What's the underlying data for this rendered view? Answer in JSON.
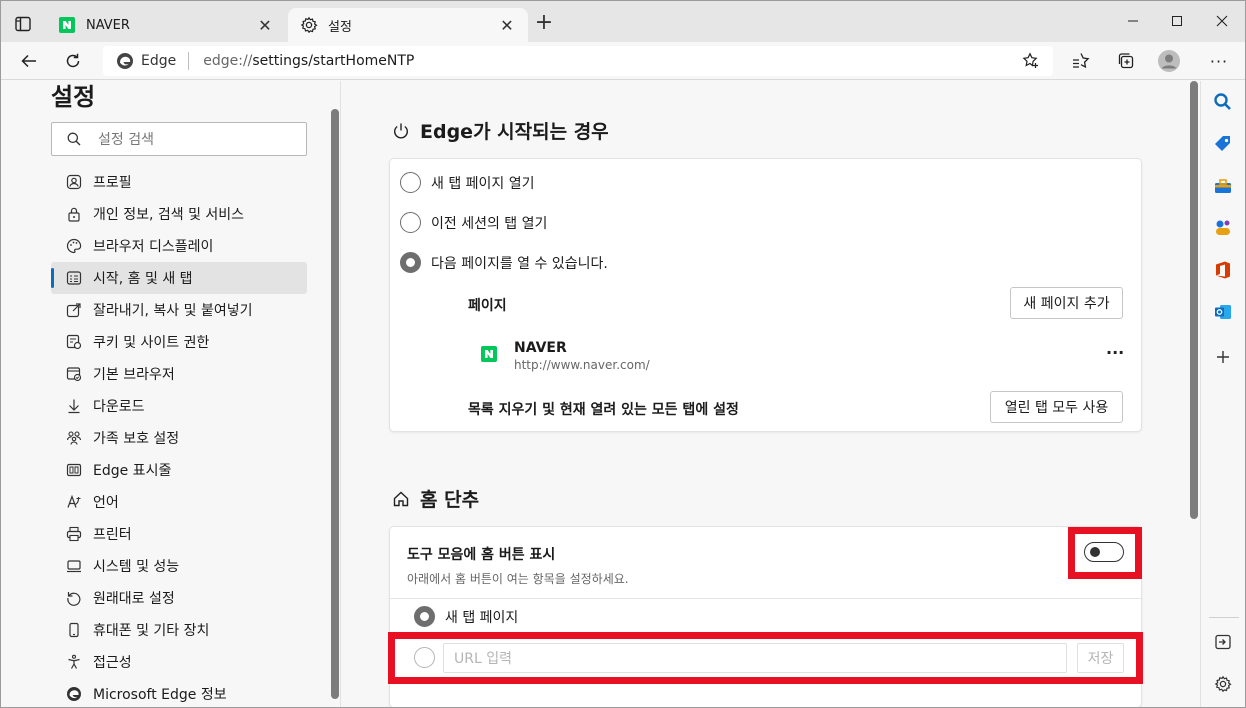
{
  "tabs": [
    {
      "title": "NAVER",
      "icon": "naver-logo-icon"
    },
    {
      "title": "설정",
      "icon": "gear-icon"
    }
  ],
  "address": {
    "site_label": "Edge",
    "url_host": "edge://",
    "url_path": "settings/startHomeNTP"
  },
  "sidebar": {
    "title": "설정",
    "search_placeholder": "설정 검색",
    "items": [
      {
        "label": "프로필",
        "icon": "profile-icon"
      },
      {
        "label": "개인 정보, 검색 및 서비스",
        "icon": "lock-icon"
      },
      {
        "label": "브라우저 디스플레이",
        "icon": "palette-icon"
      },
      {
        "label": "시작, 홈 및 새 탭",
        "icon": "start-home-icon",
        "active": true
      },
      {
        "label": "잘라내기, 복사 및 붙여넣기",
        "icon": "share-icon"
      },
      {
        "label": "쿠키 및 사이트 권한",
        "icon": "cookie-icon"
      },
      {
        "label": "기본 브라우저",
        "icon": "default-browser-icon"
      },
      {
        "label": "다운로드",
        "icon": "download-icon"
      },
      {
        "label": "가족 보호 설정",
        "icon": "family-icon"
      },
      {
        "label": "Edge 표시줄",
        "icon": "edge-bar-icon"
      },
      {
        "label": "언어",
        "icon": "language-icon"
      },
      {
        "label": "프린터",
        "icon": "printer-icon"
      },
      {
        "label": "시스템 및 성능",
        "icon": "system-icon"
      },
      {
        "label": "원래대로 설정",
        "icon": "reset-icon"
      },
      {
        "label": "휴대폰 및 기타 장치",
        "icon": "phone-icon"
      },
      {
        "label": "접근성",
        "icon": "accessibility-icon"
      },
      {
        "label": "Microsoft Edge 정보",
        "icon": "edge-logo-icon"
      }
    ]
  },
  "startup": {
    "title": "Edge가 시작되는 경우",
    "options": [
      {
        "label": "새 탭 페이지 열기",
        "selected": false
      },
      {
        "label": "이전 세션의 탭 열기",
        "selected": false
      },
      {
        "label": "다음 페이지를 열 수 있습니다.",
        "selected": true
      }
    ],
    "pages_label": "페이지",
    "add_page_button": "새 페이지 추가",
    "page": {
      "name": "NAVER",
      "url": "http://www.naver.com/",
      "more": "···"
    },
    "clear_label": "목록 지우기 및 현재 열려 있는 모든 탭에 설정",
    "use_open_tabs_button": "열린 탭 모두 사용"
  },
  "home": {
    "title": "홈 단추",
    "show_home_label": "도구 모음에 홈 버튼 표시",
    "show_home_desc": "아래에서 홈 버튼이 여는 항목을 설정하세요.",
    "toggle_on": false,
    "new_tab_label": "새 탭 페이지",
    "url_placeholder": "URL 입력",
    "save_label": "저장"
  },
  "colors": {
    "accent": "#0f6cbd",
    "highlight": "#e81123",
    "naver_green": "#03c75a"
  }
}
